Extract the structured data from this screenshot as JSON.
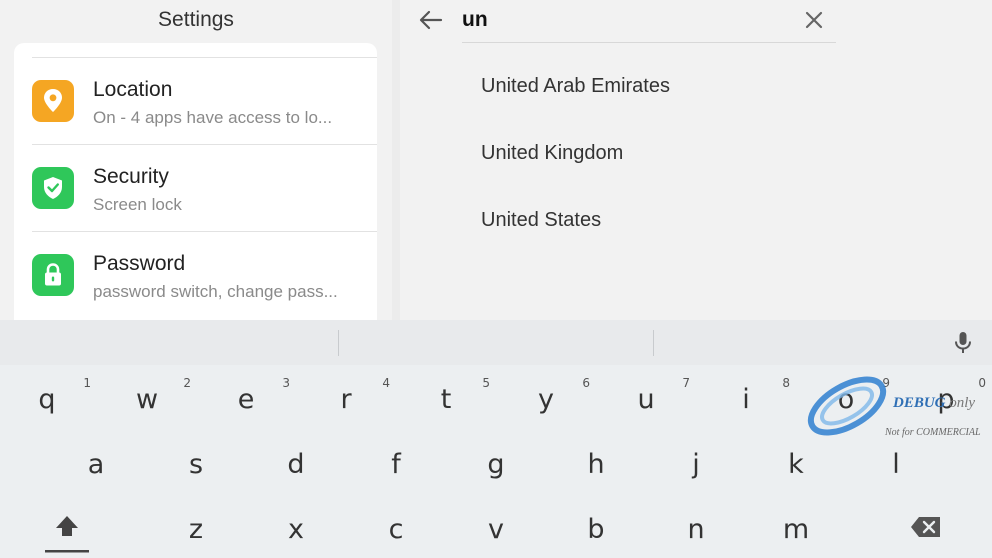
{
  "left_panel": {
    "title": "Settings",
    "items": [
      {
        "title": "Location",
        "subtitle": "On - 4 apps have access to lo...",
        "icon": "location-pin-icon",
        "icon_color": "#f5a623"
      },
      {
        "title": "Security",
        "subtitle": "Screen lock",
        "icon": "shield-check-icon",
        "icon_color": "#2fc75a"
      },
      {
        "title": "Password",
        "subtitle": "password switch, change pass...",
        "icon": "lock-icon",
        "icon_color": "#2fc75a"
      }
    ]
  },
  "search": {
    "query": "un",
    "back_icon": "arrow-left-icon",
    "clear_icon": "close-icon",
    "results": [
      "United Arab Emirates",
      "United Kingdom",
      "United States"
    ]
  },
  "keyboard": {
    "mic_icon": "microphone-icon",
    "row1": [
      {
        "key": "q",
        "hint": "1"
      },
      {
        "key": "w",
        "hint": "2"
      },
      {
        "key": "e",
        "hint": "3"
      },
      {
        "key": "r",
        "hint": "4"
      },
      {
        "key": "t",
        "hint": "5"
      },
      {
        "key": "y",
        "hint": "6"
      },
      {
        "key": "u",
        "hint": "7"
      },
      {
        "key": "i",
        "hint": "8"
      },
      {
        "key": "o",
        "hint": "9"
      },
      {
        "key": "p",
        "hint": "0"
      }
    ],
    "row2": [
      "a",
      "s",
      "d",
      "f",
      "g",
      "h",
      "j",
      "k",
      "l"
    ],
    "row3": [
      "z",
      "x",
      "c",
      "v",
      "b",
      "n",
      "m"
    ],
    "shift_icon": "shift-arrow-icon",
    "backspace_icon": "backspace-icon"
  },
  "watermark": {
    "line1": "DEBUG",
    "line1_suffix": "only",
    "line2": "Not for COMMERCIAL"
  }
}
